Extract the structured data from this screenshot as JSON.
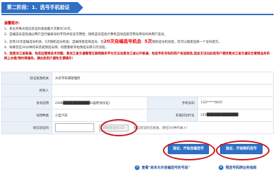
{
  "step_tab": "第二阶段：1、选号手机验证",
  "notice": {
    "title": "温馨提示：",
    "l1": "1、本业务每天短信验证码发送最大次数为10次。",
    "l2": "2、自编选号是指通过用户自行编排号码字符并验证可用性；随机选号是指计算机自动选取可用号牌号码供用户选号。",
    "l3_a": "3、您有20次自编选号机会、5次随机选号机会；自编或者是机选号，在",
    "l3_b": "20次自编选号机会",
    "l3_c": "、",
    "l3_d": "5次",
    "l3_e": "随机选号机会后，您可以随意选择一个号码提交。",
    "l4": "4、如果您在30分钟内未完成预选号牌，则需重新开始预选号牌工作流程。",
    "l5": "5、因黑龙江省联通、电信运营商技术问题，黑龙江省交通管理互联网服务平台无法向黑龙江省以外联通、电信手机号码的用户发送短信,因此无法向此类用户提供黑龙江省交通安全管理业务的网上办理/预约等服务。请此类用户避免无谓操作！"
  },
  "form": {
    "rows": {
      "dept_label": "验证发放机关",
      "dept_value": "大庆市车辆管理所",
      "owner_label": "所有人",
      "owner_value": "",
      "id_label": "身份证明",
      "id_value": "2306███████████0(居民身份证)",
      "phone_label": "手机号码",
      "phone_value": "133*****0047",
      "plate_type_label": "号牌种类",
      "plate_type_value": "小型汽车",
      "vin_label": "车辆识别代号",
      "vin_value": "LSV█████████████",
      "sms_label": "短信验证码"
    },
    "sms_button": "获取验证码(42)",
    "sms_note": "短信验证码已发送，请在5分钟内录入！"
  },
  "actions": {
    "custom_btn": "验证，开始自编选号",
    "random_btn": "验证，开始随机选号"
  },
  "links": {
    "link1": "查看\"尚未允许自编选号的号段\"",
    "link2": "预选号码牌业务指南"
  },
  "colors": {
    "primary": "#2f6fc4",
    "alert": "#e00000",
    "circle": "#c8161d"
  }
}
